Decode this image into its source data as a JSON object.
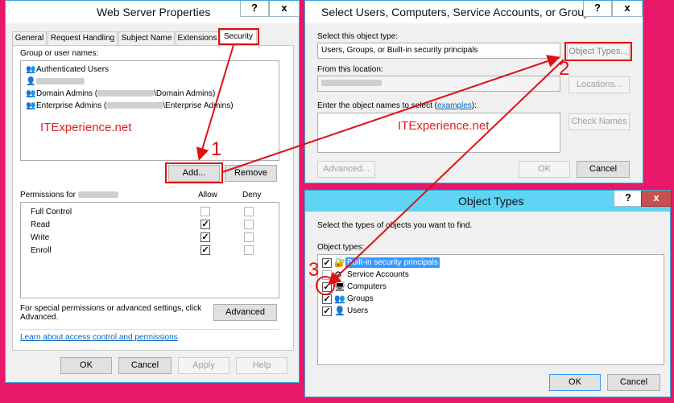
{
  "web_server_properties": {
    "title": "Web Server Properties",
    "help_btn": "?",
    "close_btn": "x",
    "tabs": [
      "General",
      "Request Handling",
      "Subject Name",
      "Extensions",
      "Security"
    ],
    "group_label": "Group or user names:",
    "users": [
      {
        "name": "Authenticated Users",
        "icon": "users-icon"
      },
      {
        "name": "",
        "icon": "user-icon"
      },
      {
        "name_pre": "Domain Admins (",
        "name_post": "\\Domain Admins)",
        "icon": "group-icon"
      },
      {
        "name_pre": "Enterprise Admins (",
        "name_post": "\\Enterprise Admins)",
        "icon": "group-icon"
      }
    ],
    "watermark": "ITExperience.net",
    "add_btn": "Add...",
    "remove_btn": "Remove",
    "permissions_label": "Permissions for",
    "allow_header": "Allow",
    "deny_header": "Deny",
    "permissions": [
      {
        "name": "Full Control",
        "allow": false,
        "deny": false
      },
      {
        "name": "Read",
        "allow": true,
        "deny": false
      },
      {
        "name": "Write",
        "allow": true,
        "deny": false
      },
      {
        "name": "Enroll",
        "allow": true,
        "deny": false
      }
    ],
    "special_text": "For special permissions or advanced settings, click Advanced.",
    "advanced_btn": "Advanced",
    "learn_link": "Learn about access control and permissions",
    "ok_btn": "OK",
    "cancel_btn": "Cancel",
    "apply_btn": "Apply",
    "help_btn2": "Help"
  },
  "select_users": {
    "title": "Select Users, Computers, Service Accounts, or Groups",
    "help_btn": "?",
    "close_btn": "x",
    "object_type_label": "Select this object type:",
    "object_type_value": "Users, Groups, or Built-in security principals",
    "object_types_btn": "Object Types...",
    "location_label": "From this location:",
    "locations_btn": "Locations...",
    "names_label": "Enter the object names to select (",
    "names_link": "examples",
    "names_label_end": "):",
    "watermark": "ITExperience.net",
    "check_names_btn": "Check Names",
    "advanced_btn": "Advanced...",
    "ok_btn": "OK",
    "cancel_btn": "Cancel"
  },
  "object_types": {
    "title": "Object Types",
    "help_btn": "?",
    "close_btn": "x",
    "description": "Select the types of objects you want to find.",
    "list_label": "Object types:",
    "items": [
      {
        "name": "Built-in security principals",
        "checked": true,
        "selected": true,
        "icon": "security-principals-icon"
      },
      {
        "name": "Service Accounts",
        "checked": false,
        "selected": false,
        "icon": "service-accounts-icon"
      },
      {
        "name": "Computers",
        "checked": true,
        "selected": false,
        "icon": "computer-icon"
      },
      {
        "name": "Groups",
        "checked": true,
        "selected": false,
        "icon": "groups-icon"
      },
      {
        "name": "Users",
        "checked": true,
        "selected": false,
        "icon": "user-icon"
      }
    ],
    "ok_btn": "OK",
    "cancel_btn": "Cancel"
  },
  "annotations": {
    "step1": "1",
    "step2": "2",
    "step3": "3"
  },
  "colors": {
    "background": "#e8176a",
    "titlebar": "#5fd4f4",
    "annotation_red": "#e01010",
    "selection": "#3399ff"
  }
}
